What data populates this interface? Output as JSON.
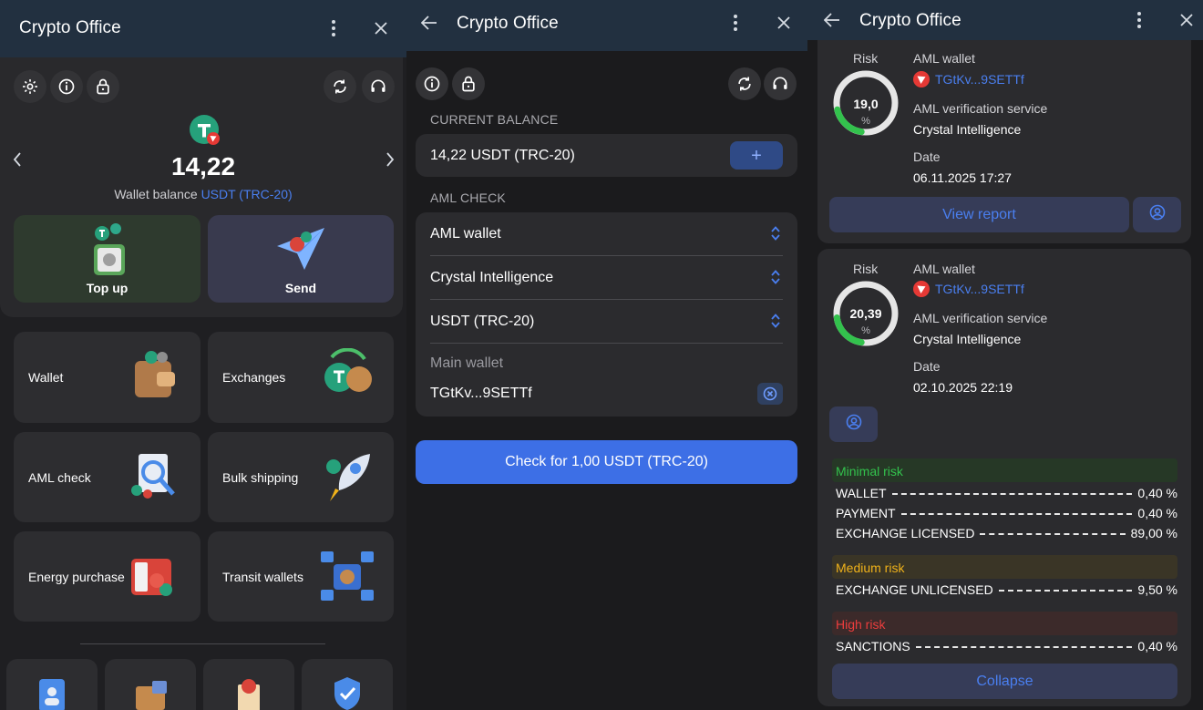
{
  "app_title": "Crypto Office",
  "colors": {
    "accent": "#3d6fe6",
    "link": "#4a7ff0",
    "minimal": "#33c24d",
    "medium": "#f0b21a",
    "high": "#ec3d3d"
  },
  "wallet_screen": {
    "balance": "14,22",
    "balance_label": "Wallet balance",
    "balance_currency": "USDT (TRC-20)",
    "top_up": "Top up",
    "send": "Send",
    "tiles": [
      "Wallet",
      "Exchanges",
      "AML check",
      "Bulk shipping",
      "Energy purchase",
      "Transit wallets"
    ]
  },
  "aml_form": {
    "current_balance_header": "CURRENT BALANCE",
    "current_balance_value": "14,22 USDT (TRC-20)",
    "add_symbol": "+",
    "aml_check_header": "AML CHECK",
    "check_type": "AML wallet",
    "service": "Crystal Intelligence",
    "currency": "USDT (TRC-20)",
    "wallet_placeholder": "Main wallet",
    "wallet_value": "TGtKv...9SETTf",
    "submit": "Check for 1,00 USDT (TRC-20)"
  },
  "results": {
    "card1": {
      "risk_label": "Risk",
      "risk_value": "19,0",
      "risk_fraction": 0.19,
      "risk_unit": "%",
      "type_label": "AML wallet",
      "address": "TGtKv...9SETTf",
      "service_label": "AML verification service",
      "service": "Crystal Intelligence",
      "date_label": "Date",
      "date": "06.11.2025 17:27",
      "view_report": "View report"
    },
    "card2": {
      "risk_label": "Risk",
      "risk_value": "20,39",
      "risk_fraction": 0.2039,
      "risk_unit": "%",
      "type_label": "AML wallet",
      "address": "TGtKv...9SETTf",
      "service_label": "AML verification service",
      "service": "Crystal Intelligence",
      "date_label": "Date",
      "date": "02.10.2025 22:19",
      "minimal_label": "Minimal risk",
      "medium_label": "Medium risk",
      "high_label": "High risk",
      "rows": {
        "wallet": {
          "name": "WALLET",
          "pct": "0,40 %"
        },
        "payment": {
          "name": "PAYMENT",
          "pct": "0,40 %"
        },
        "exchange_licensed": {
          "name": "EXCHANGE LICENSED",
          "pct": "89,00 %"
        },
        "exchange_unlicensed": {
          "name": "EXCHANGE UNLICENSED",
          "pct": "9,50 %"
        },
        "sanctions": {
          "name": "SANCTIONS",
          "pct": "0,40 %"
        }
      },
      "collapse": "Collapse"
    }
  }
}
